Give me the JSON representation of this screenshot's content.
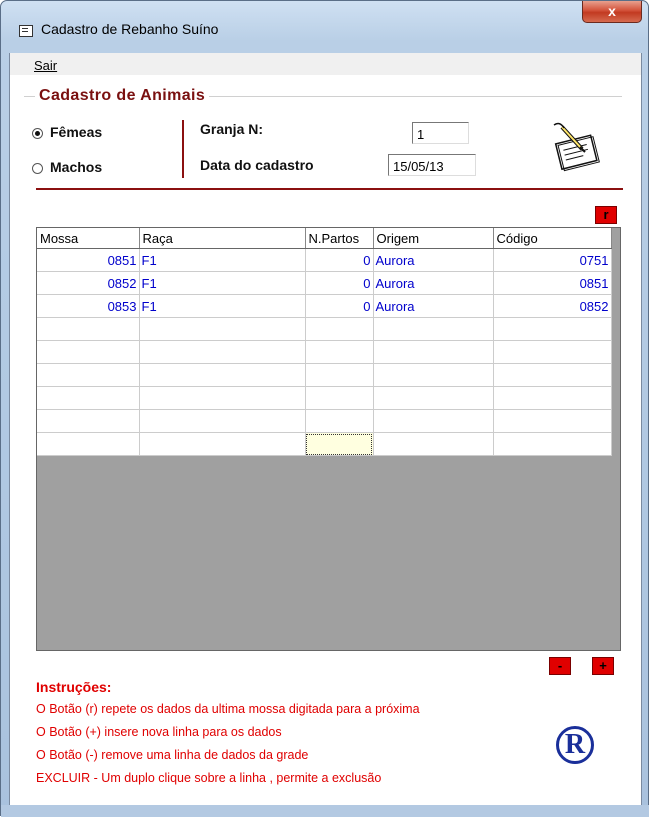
{
  "window": {
    "title": "Cadastro de Rebanho Suíno",
    "close_label": "x"
  },
  "menu": {
    "items": [
      "Sair"
    ]
  },
  "form": {
    "group_title": "Cadastro de Animais",
    "sex_options": [
      {
        "label": "Fêmeas",
        "selected": true
      },
      {
        "label": "Machos",
        "selected": false
      }
    ],
    "granja_label": "Granja N:",
    "granja_value": "1",
    "data_label": "Data do cadastro",
    "data_value": "15/05/13"
  },
  "buttons": {
    "repeat": "r",
    "remove": "-",
    "add": "+"
  },
  "grid": {
    "columns": [
      "Mossa",
      "Raça",
      "N.Partos",
      "Origem",
      "Código"
    ],
    "rows": [
      [
        "0851",
        "F1",
        "0",
        "Aurora",
        "0751"
      ],
      [
        "0852",
        "F1",
        "0",
        "Aurora",
        "0851"
      ],
      [
        "0853",
        "F1",
        "0",
        "Aurora",
        "0852"
      ],
      [
        "",
        "",
        "",
        "",
        ""
      ],
      [
        "",
        "",
        "",
        "",
        ""
      ],
      [
        "",
        "",
        "",
        "",
        ""
      ],
      [
        "",
        "",
        "",
        "",
        ""
      ],
      [
        "",
        "",
        "",
        "",
        ""
      ],
      [
        "",
        "",
        "",
        "",
        ""
      ]
    ]
  },
  "instructions": {
    "title": "Instruções:",
    "lines": [
      "O Botão (r) repete os dados da ultima mossa digitada para a próxima",
      "O Botão (+) insere nova linha para os dados",
      "O Botão (-) remove uma linha de dados da grade",
      "EXCLUIR - Um duplo clique sobre a linha , permite a exclusão"
    ]
  },
  "icons": {
    "title": "form-window-icon",
    "note": "notepad-pen-icon",
    "registered": "registered-r-icon"
  },
  "colors": {
    "accent": "#8b1010",
    "button_red": "#e00000",
    "cell_text": "#0000cc",
    "grid_bg": "#a0a0a0"
  }
}
